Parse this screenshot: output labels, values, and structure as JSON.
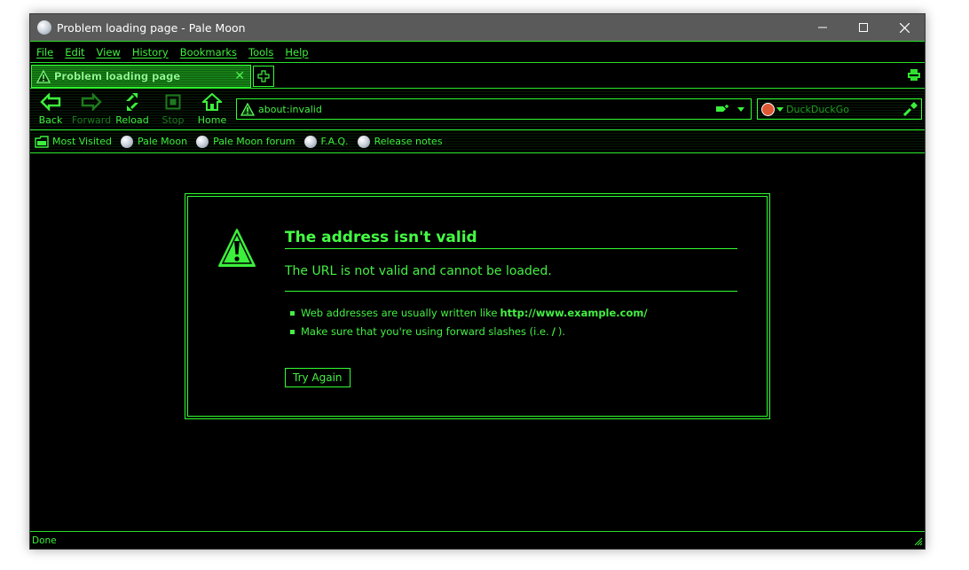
{
  "window": {
    "title": "Problem loading page - Pale Moon"
  },
  "menubar": {
    "items": [
      "File",
      "Edit",
      "View",
      "History",
      "Bookmarks",
      "Tools",
      "Help"
    ]
  },
  "tabs": [
    {
      "label": "Problem loading page",
      "active": true
    }
  ],
  "navbar": {
    "back": "Back",
    "forward": "Forward",
    "reload": "Reload",
    "stop": "Stop",
    "home": "Home",
    "url": "about:invalid",
    "search_placeholder": "DuckDuckGo"
  },
  "bookmarks": {
    "most_visited": "Most Visited",
    "items": [
      "Pale Moon",
      "Pale Moon forum",
      "F.A.Q.",
      "Release notes"
    ]
  },
  "error": {
    "title": "The address isn't valid",
    "description": "The URL is not valid and cannot be loaded.",
    "hint1_prefix": "Web addresses are usually written like",
    "hint1_code": "http://www.example.com/",
    "hint2_prefix": "Make sure that you're using forward slashes (i.e.",
    "hint2_code": "/",
    "hint2_suffix": ").",
    "button": "Try Again"
  },
  "status": {
    "text": "Done"
  },
  "colors": {
    "accent": "#30ff30",
    "background": "#000000",
    "titlebar": "#5a5a5a"
  }
}
